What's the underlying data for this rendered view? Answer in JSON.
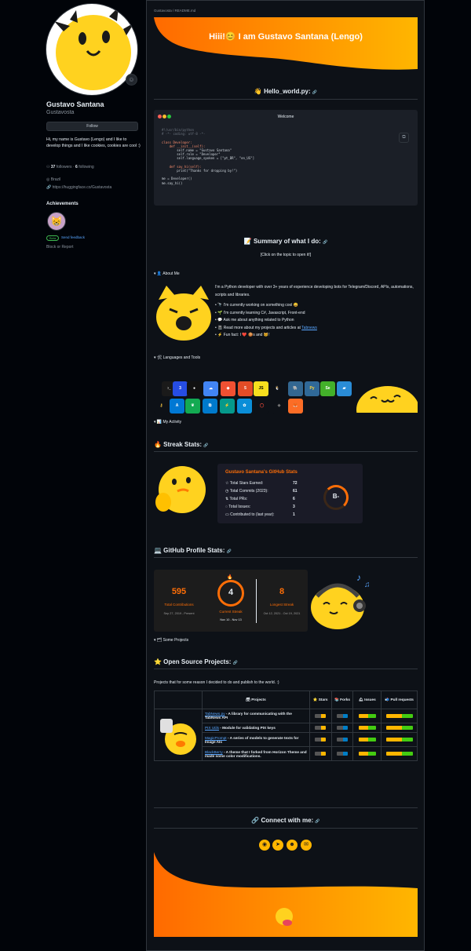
{
  "profile": {
    "name": "Gustavo Santana",
    "username": "Gustavosta",
    "follow_label": "Follow",
    "bio": "Hi, my name is Gustavo (Lengo) and I like to develop things and I like cookies, cookies are cool :)",
    "followers_count": "37",
    "followers_label": "followers",
    "following_count": "6",
    "following_label": "following",
    "location": "Brazil",
    "website": "https://huggingface.co/Gustavosta",
    "achievements_title": "Achievements",
    "beta_label": "Beta",
    "feedback_label": "Send feedback",
    "block_label": "Block or Report"
  },
  "readme": {
    "breadcrumb": "Gustavosta / README.md",
    "banner_title": "Hiii!😊 I am Gustavo Santana (Lengo)",
    "hello_heading": "👋 Hello_world.py:",
    "code_window_title": "Welcome",
    "code_lines": [
      "#!/usr/bin/python",
      "# -*- coding: utf-8 -*-",
      "",
      "class Developer:",
      "    def __init__(self):",
      "        self.name = \"Gustavo Santana\"",
      "        self.role = \"Developer\"",
      "        self.language_spoken = [\"pt_BR\", \"en_US\"]",
      "",
      "    def say_hi(self):",
      "        print(\"Thanks for dropping by!\")",
      "",
      "me = Developer()",
      "me.say_hi()"
    ],
    "summary_heading": "📝 Summary of what I do:",
    "summary_note": "[Click on the topic to open it!]",
    "about_toggle": "▾ 👤 About Me",
    "about_items": [
      "I'm a Python developer with over 3+ years of experience developing bots for Telegram/Discord, APIs, automations, scripts and libraries.",
      "🔭 I'm currently working on something cool 😄",
      "🌱 I'm currently learning C#, Javascript, Front-end",
      "💬 Ask me about anything related to Python",
      "📓 Read more about my projects and articles at",
      "⚡ Fun fact: I ❤️ 🍪s and 🐱!"
    ],
    "about_link": "Tabnews",
    "languages_toggle": "▾ 🛠 Languages and Tools",
    "activity_toggle": "▾ 📊 My Activity",
    "streak_heading": "🔥 Streak Stats:",
    "stats_card": {
      "title": "Gustavo Santana's GitHub Stats",
      "rows": [
        {
          "label": "Total Stars Earned:",
          "value": "72"
        },
        {
          "label": "Total Commits (2023):",
          "value": "61"
        },
        {
          "label": "Total PRs:",
          "value": "6"
        },
        {
          "label": "Total Issues:",
          "value": "3"
        },
        {
          "label": "Contributed to (last year):",
          "value": "1"
        }
      ],
      "rank": "B-"
    },
    "profile_stats_heading": "💻 GitHub Profile Stats:",
    "streak_card": {
      "total": "595",
      "total_label": "Total Contributions",
      "total_range": "Sep 27, 2019 - Present",
      "current": "4",
      "current_label": "Current Streak",
      "current_range": "Nov 10 - Nov 13",
      "longest": "8",
      "longest_label": "Longest Streak",
      "longest_range": "Oct 12, 2021 - Oct 19, 2021"
    },
    "projects_toggle": "▾ 🗂 Some Projects",
    "open_source_heading": "⭐ Open Source Projects:",
    "open_source_intro": "Projects that for some reason I decided to do and publish to the world. :)",
    "table_headers": [
      "🗃 Projects",
      "⭐ Stars",
      "📚 Forks",
      "🛎 Issues",
      "📬 Pull requests"
    ],
    "projects": [
      {
        "name": "TabNews.py",
        "desc": " - A library for communicating with the TabNews API"
      },
      {
        "name": "PIX Utils",
        "desc": " - Module for validating PIX keys"
      },
      {
        "name": "MagicPrompt",
        "desc": " - A series of models to generate texts for Image AIs"
      },
      {
        "name": "BlackBerry",
        "desc": " - A theme that I forked from Horizon Theme and made some color modifications."
      }
    ],
    "connect_heading": "🔗 Connect with me:",
    "social_icons": [
      "github-icon",
      "telegram-icon",
      "discord-icon",
      "email-icon"
    ]
  },
  "colors": {
    "accent_orange": "#fe6e07",
    "banner_start": "#ff6a00",
    "banner_end": "#ffb600",
    "link_blue": "#58a6ff"
  }
}
